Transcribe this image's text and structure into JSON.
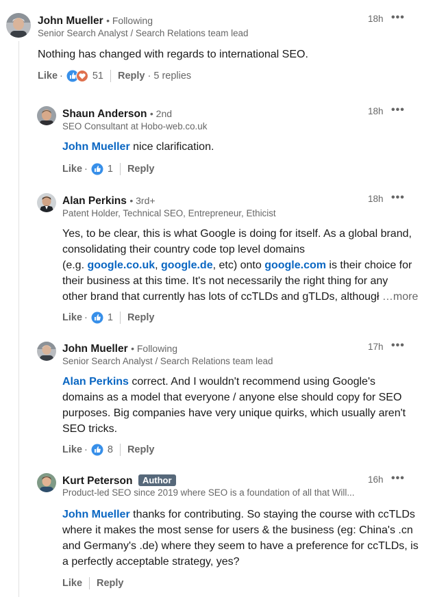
{
  "comments": [
    {
      "name": "John Mueller",
      "degree": "• Following",
      "headline": "Senior Search Analyst / Search Relations team lead",
      "time": "18h",
      "body": "Nothing has changed with regards to international SEO.",
      "like_label": "Like",
      "reaction_count": "51",
      "reply_label": "Reply",
      "replies_label": "· 5 replies",
      "reactions": [
        "like-icon",
        "love-icon"
      ]
    },
    {
      "name": "Shaun Anderson",
      "degree": "• 2nd",
      "headline": "SEO Consultant at Hobo-web.co.uk",
      "time": "18h",
      "mention": "John Mueller",
      "body": " nice clarification.",
      "like_label": "Like",
      "reaction_count": "1",
      "reply_label": "Reply",
      "reactions": [
        "like-icon"
      ]
    },
    {
      "name": "Alan Perkins",
      "degree": "• 3rd+",
      "headline": "Patent Holder, Technical SEO, Entrepreneur, Ethicist",
      "time": "18h",
      "body_line1": "Yes, to be clear, this is what Google is doing for itself. As a global brand,",
      "body_line2": "consolidating their country code top level domains",
      "body_line3_a": "(e.g. ",
      "link1": "google.co.uk",
      "body_line3_b": ", ",
      "link2": "google.de",
      "body_line3_c": ", etc) onto ",
      "link3": "google.com",
      "body_line3_d": " is their choice for",
      "body_line4": "their business at this time. It's not necessarily the right thing for any",
      "body_line5": "other brand that currently has lots of ccTLDs and gTLDs, althougł",
      "more_label": "…more",
      "like_label": "Like",
      "reaction_count": "1",
      "reply_label": "Reply",
      "reactions": [
        "like-icon"
      ]
    },
    {
      "name": "John Mueller",
      "degree": "• Following",
      "headline": "Senior Search Analyst / Search Relations team lead",
      "time": "17h",
      "mention": "Alan Perkins",
      "body_line1": " correct. And I wouldn't recommend using Google's",
      "body_line2": "domains as a model that everyone / anyone else should copy for SEO",
      "body_line3": "purposes. Big companies have very unique quirks, which usually aren't",
      "body_line4": "SEO tricks.",
      "like_label": "Like",
      "reaction_count": "8",
      "reply_label": "Reply",
      "reactions": [
        "like-icon"
      ]
    },
    {
      "name": "Kurt Peterson",
      "badge": "Author",
      "headline": "Product-led SEO since 2019 where SEO is a foundation of all that Will...",
      "time": "16h",
      "mention": "John Mueller",
      "body_line1": " thanks for contributing. So staying the course with ccTLDs",
      "body_line2": "where it makes the most sense for users & the business (eg: China's .cn",
      "body_line3": "and Germany's .de) where they seem to have a preference for ccTLDs, is",
      "body_line4": "a perfectly acceptable strategy, yes?",
      "like_label": "Like",
      "reply_label": "Reply"
    }
  ],
  "more_icon": "ellipsis-icon",
  "colors": {
    "link": "#0a66c2",
    "muted": "#666666",
    "badge": "#56687a"
  }
}
